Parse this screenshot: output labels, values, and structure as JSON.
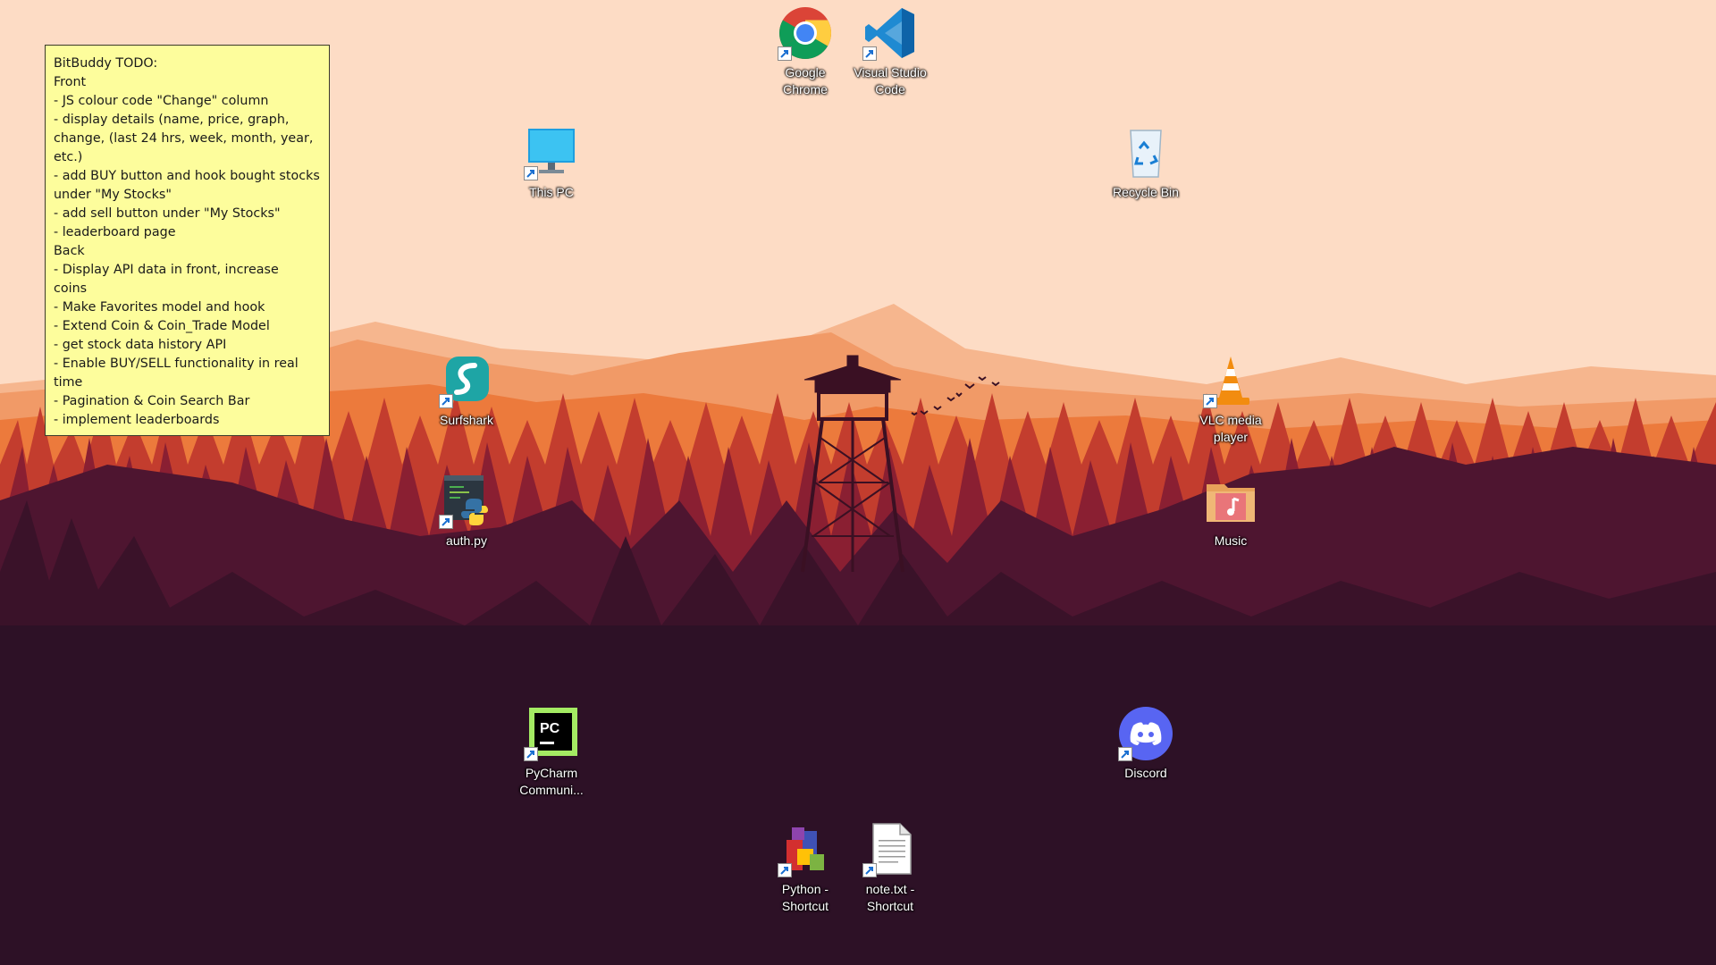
{
  "sticky_note": {
    "lines": [
      "BitBuddy TODO:",
      "Front",
      "- JS colour code \"Change\" column",
      "- display details (name, price, graph,",
      "change, (last 24 hrs, week, month, year,",
      "etc.)",
      "- add BUY button and hook bought stocks",
      "under \"My Stocks\"",
      "- add sell button under \"My Stocks\"",
      "- leaderboard page",
      "Back",
      "- Display API data in front, increase",
      "coins",
      "- Make Favorites model and hook",
      "- Extend Coin & Coin_Trade Model",
      "- get stock data history API",
      "- Enable BUY/SELL functionality in real",
      "time",
      "- Pagination & Coin Search Bar",
      "- implement leaderboards"
    ]
  },
  "icons": {
    "chrome": {
      "label_line1": "Google",
      "label_line2": "Chrome",
      "icon": "chrome-icon"
    },
    "vscode": {
      "label_line1": "Visual Studio",
      "label_line2": "Code",
      "icon": "vscode-icon"
    },
    "this_pc": {
      "label_line1": "This PC",
      "icon": "monitor-icon"
    },
    "recycle_bin": {
      "label_line1": "Recycle Bin",
      "icon": "recycle-bin-icon"
    },
    "surfshark": {
      "label_line1": "Surfshark",
      "icon": "surfshark-icon"
    },
    "vlc": {
      "label_line1": "VLC media",
      "label_line2": "player",
      "icon": "vlc-cone-icon"
    },
    "auth_py": {
      "label_line1": "auth.py",
      "icon": "python-file-icon"
    },
    "music": {
      "label_line1": "Music",
      "icon": "music-folder-icon"
    },
    "pycharm": {
      "label_line1": "PyCharm",
      "label_line2": "Communi...",
      "icon": "pycharm-icon"
    },
    "discord": {
      "label_line1": "Discord",
      "icon": "discord-icon"
    },
    "python_shortcut": {
      "label_line1": "Python -",
      "label_line2": "Shortcut",
      "icon": "python-installer-icon"
    },
    "note_shortcut": {
      "label_line1": "note.txt -",
      "label_line2": "Shortcut",
      "icon": "text-file-icon"
    }
  },
  "colors": {
    "sky": "#fddcc5",
    "mountain_far": "#f3a173",
    "mountain_mid": "#ee7b3e",
    "forest_far": "#c33d2e",
    "forest_mid": "#8a1f32",
    "forest_near": "#4e1530",
    "ground": "#2d1126",
    "sticky_bg": "#fdfd9c"
  }
}
